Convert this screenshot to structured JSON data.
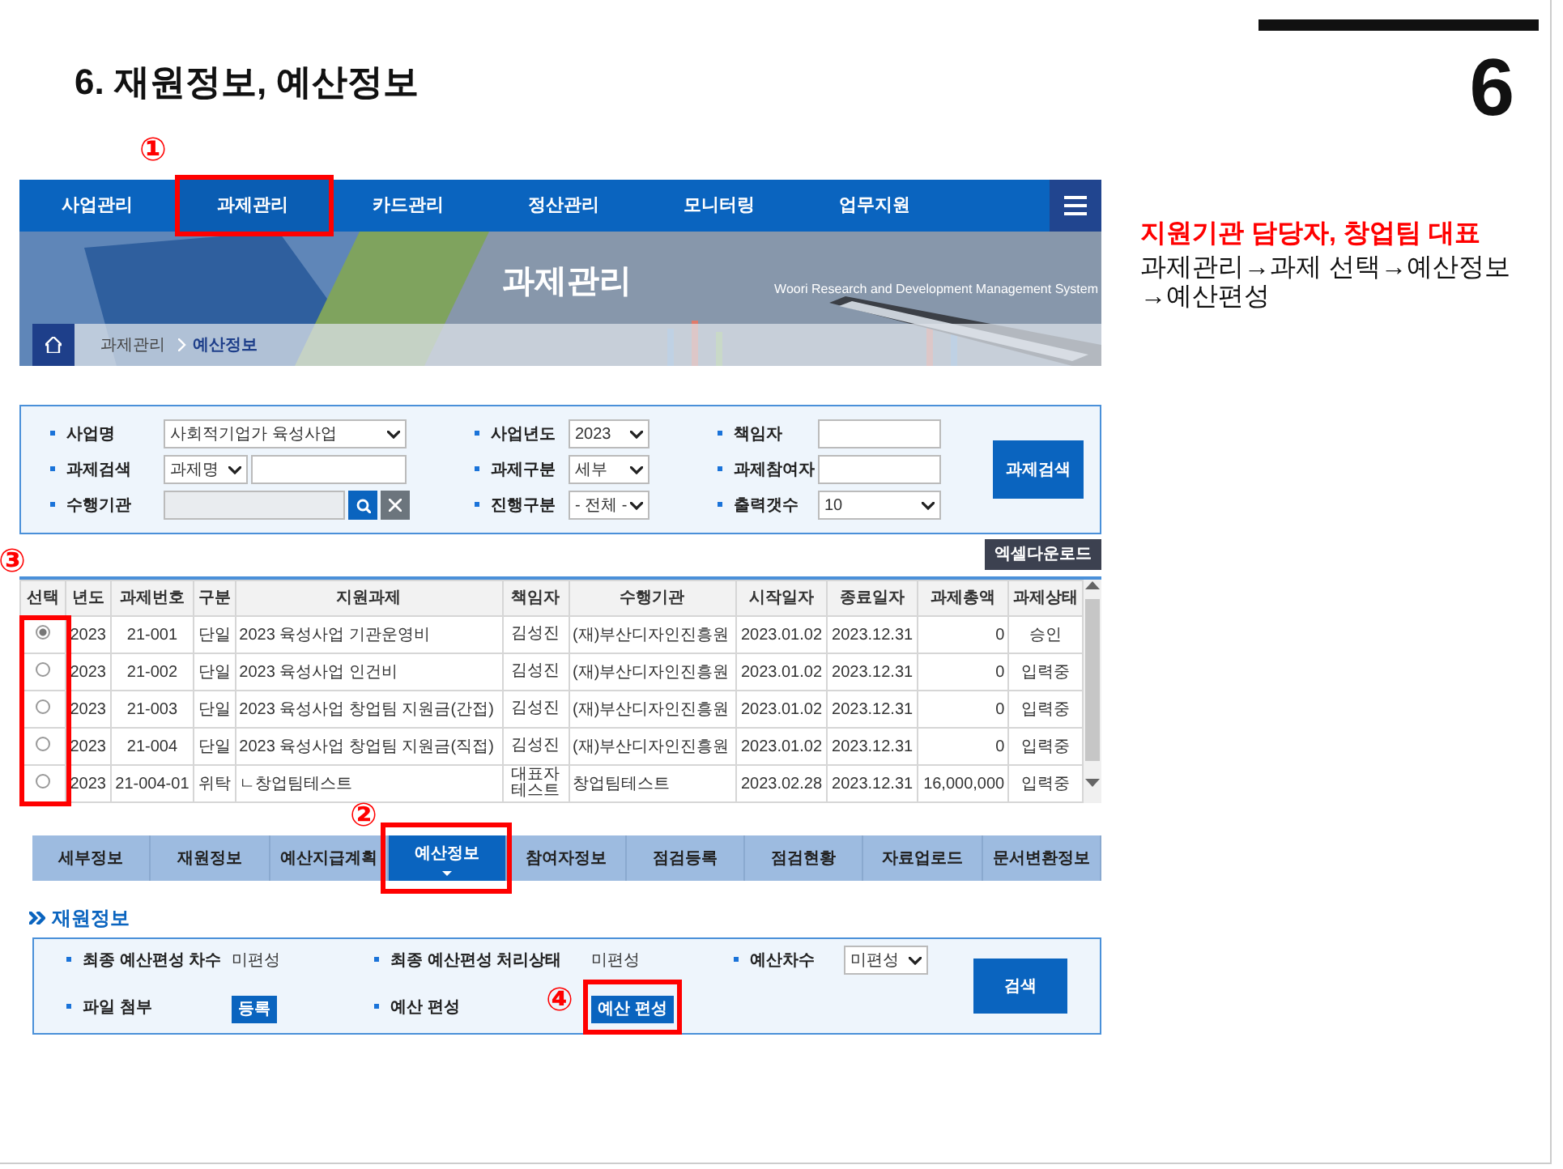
{
  "slide": {
    "title": "6. 재원정보, 예산정보",
    "page_number": "6"
  },
  "nav": {
    "items": [
      {
        "label": "사업관리",
        "selected": false
      },
      {
        "label": "과제관리",
        "selected": true,
        "callout": "①"
      },
      {
        "label": "카드관리",
        "selected": false
      },
      {
        "label": "정산관리",
        "selected": false
      },
      {
        "label": "모니터링",
        "selected": false
      },
      {
        "label": "업무지원",
        "selected": false
      }
    ]
  },
  "banner": {
    "title": "과제관리",
    "subtitle": "Woori Research and Development Management System"
  },
  "breadcrumb": [
    "과제관리",
    "예산정보"
  ],
  "search": {
    "fields": [
      {
        "label": "사업명",
        "kind": "select",
        "value": "사회적기업가 육성사업"
      },
      {
        "label": "사업년도",
        "kind": "select",
        "value": "2023"
      },
      {
        "label": "책임자",
        "kind": "text"
      },
      {
        "label": "과제검색",
        "kind": "select_text",
        "value": "과제명"
      },
      {
        "label": "과제구분",
        "kind": "select",
        "value": "세부"
      },
      {
        "label": "과제참여자",
        "kind": "text"
      },
      {
        "label": "수행기관",
        "kind": "lookup"
      },
      {
        "label": "진행구분",
        "kind": "select",
        "value": "- 전체 -"
      },
      {
        "label": "출력갯수",
        "kind": "select",
        "value": "10"
      }
    ],
    "button": "과제검색"
  },
  "excel_button": "엑셀다운로드",
  "table": {
    "callout": "③",
    "columns": [
      "선택",
      "년도",
      "과제번호",
      "구분",
      "지원과제",
      "책임자",
      "수행기관",
      "시작일자",
      "종료일자",
      "과제총액",
      "과제상태"
    ],
    "rows": [
      {
        "selected": true,
        "cells": [
          "",
          "2023",
          "21-001",
          "단일",
          "2023 육성사업 기관운영비",
          "김성진",
          "(재)부산디자인진흥원",
          "2023.01.02",
          "2023.12.31",
          "0",
          "승인"
        ]
      },
      {
        "selected": false,
        "cells": [
          "",
          "2023",
          "21-002",
          "단일",
          "2023 육성사업 인건비",
          "김성진",
          "(재)부산디자인진흥원",
          "2023.01.02",
          "2023.12.31",
          "0",
          "입력중"
        ]
      },
      {
        "selected": false,
        "cells": [
          "",
          "2023",
          "21-003",
          "단일",
          "2023 육성사업 창업팀 지원금(간접)",
          "김성진",
          "(재)부산디자인진흥원",
          "2023.01.02",
          "2023.12.31",
          "0",
          "입력중"
        ]
      },
      {
        "selected": false,
        "cells": [
          "",
          "2023",
          "21-004",
          "단일",
          "2023 육성사업 창업팀 지원금(직접)",
          "김성진",
          "(재)부산디자인진흥원",
          "2023.01.02",
          "2023.12.31",
          "0",
          "입력중"
        ]
      },
      {
        "selected": false,
        "cells": [
          "",
          "2023",
          "21-004-01",
          "위탁",
          "ㄴ창업팀테스트",
          "대표자테스트",
          "창업팀테스트",
          "2023.02.28",
          "2023.12.31",
          "16,000,000",
          "입력중"
        ]
      }
    ]
  },
  "tabs": [
    {
      "label": "세부정보",
      "selected": false
    },
    {
      "label": "재원정보",
      "selected": false
    },
    {
      "label": "예산지급계획",
      "selected": false
    },
    {
      "label": "예산정보",
      "selected": true,
      "callout": "②"
    },
    {
      "label": "참여자정보",
      "selected": false
    },
    {
      "label": "점검등록",
      "selected": false
    },
    {
      "label": "점검현황",
      "selected": false
    },
    {
      "label": "자료업로드",
      "selected": false
    },
    {
      "label": "문서변환정보",
      "selected": false
    }
  ],
  "section": {
    "title": "재원정보",
    "fields": [
      {
        "label": "최종 예산편성 차수",
        "kind": "text",
        "value": "미편성"
      },
      {
        "label": "최종 예산편성 처리상태",
        "kind": "text",
        "value": "미편성"
      },
      {
        "label": "예산차수",
        "kind": "select",
        "value": "미편성"
      },
      {
        "label": "파일 첨부",
        "kind": "button",
        "value": "등록"
      },
      {
        "label": "예산 편성",
        "kind": "button",
        "value": "예산 편성",
        "callout": "④"
      }
    ],
    "button": "검색"
  },
  "note": {
    "heading": "지원기관 담당자, 창업팀 대표",
    "lines": [
      "과제관리→과제 선택→예산정보",
      "→예산편성"
    ]
  }
}
